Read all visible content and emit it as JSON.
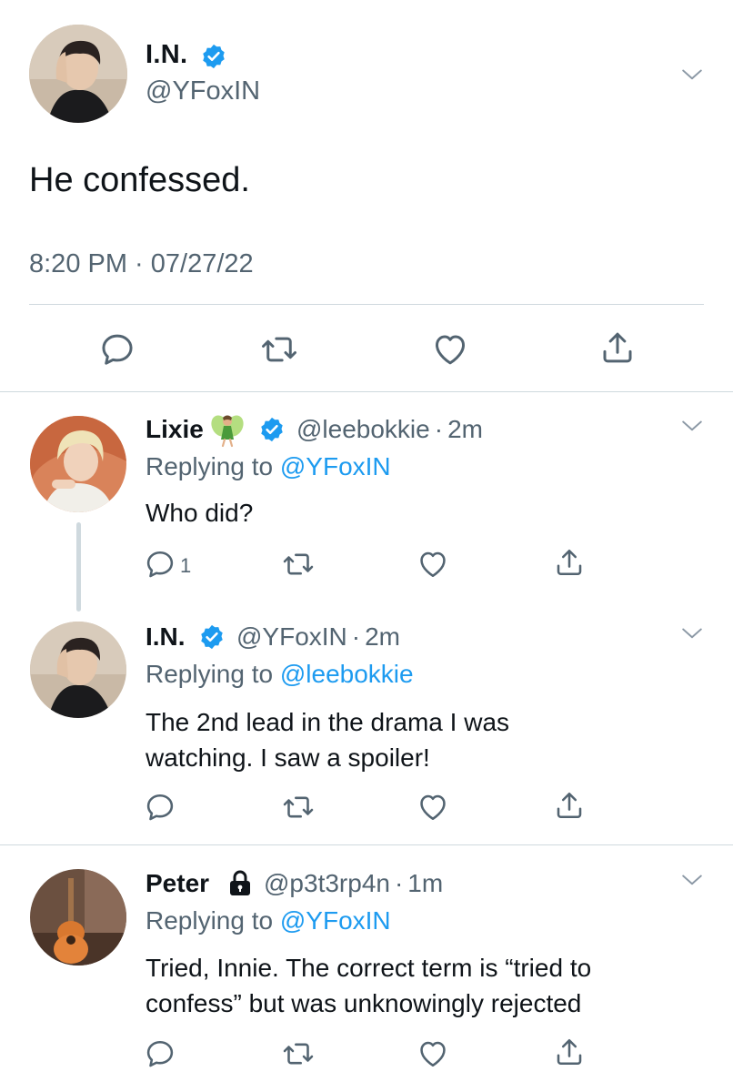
{
  "main_tweet": {
    "name": "I.N.",
    "handle": "@YFoxIN",
    "text": "He confessed.",
    "timestamp": "8:20 PM · 07/27/22",
    "verified": true
  },
  "replies": [
    {
      "name": "Lixie",
      "name_emoji": "fairy-emoji",
      "verified": true,
      "handle": "@leebokkie",
      "time": "2m",
      "replying_label": "Replying to",
      "replying_to": "@YFoxIN",
      "text": "Who did?",
      "reply_count": "1"
    },
    {
      "name": "I.N.",
      "verified": true,
      "handle": "@YFoxIN",
      "time": "2m",
      "replying_label": "Replying to",
      "replying_to": "@leebokkie",
      "text_line1": "The 2nd lead in the drama I was",
      "text_line2": "watching. I saw a spoiler!"
    },
    {
      "name": "Peter",
      "locked": true,
      "handle": "@p3t3rp4n",
      "time": "1m",
      "replying_label": "Replying to",
      "replying_to": "@YFoxIN",
      "text_line1": "Tried, Innie. The correct term is “tried to",
      "text_line2": "confess” but was unknowingly rejected"
    }
  ],
  "separator": "·",
  "colors": {
    "link": "#1d9bf0",
    "verified": "#1d9bf0",
    "muted": "#536471",
    "border": "#cfd9de"
  },
  "icons": [
    "reply-icon",
    "retweet-icon",
    "like-icon",
    "share-icon",
    "verified-badge-icon",
    "chevron-down-icon",
    "lock-icon"
  ]
}
